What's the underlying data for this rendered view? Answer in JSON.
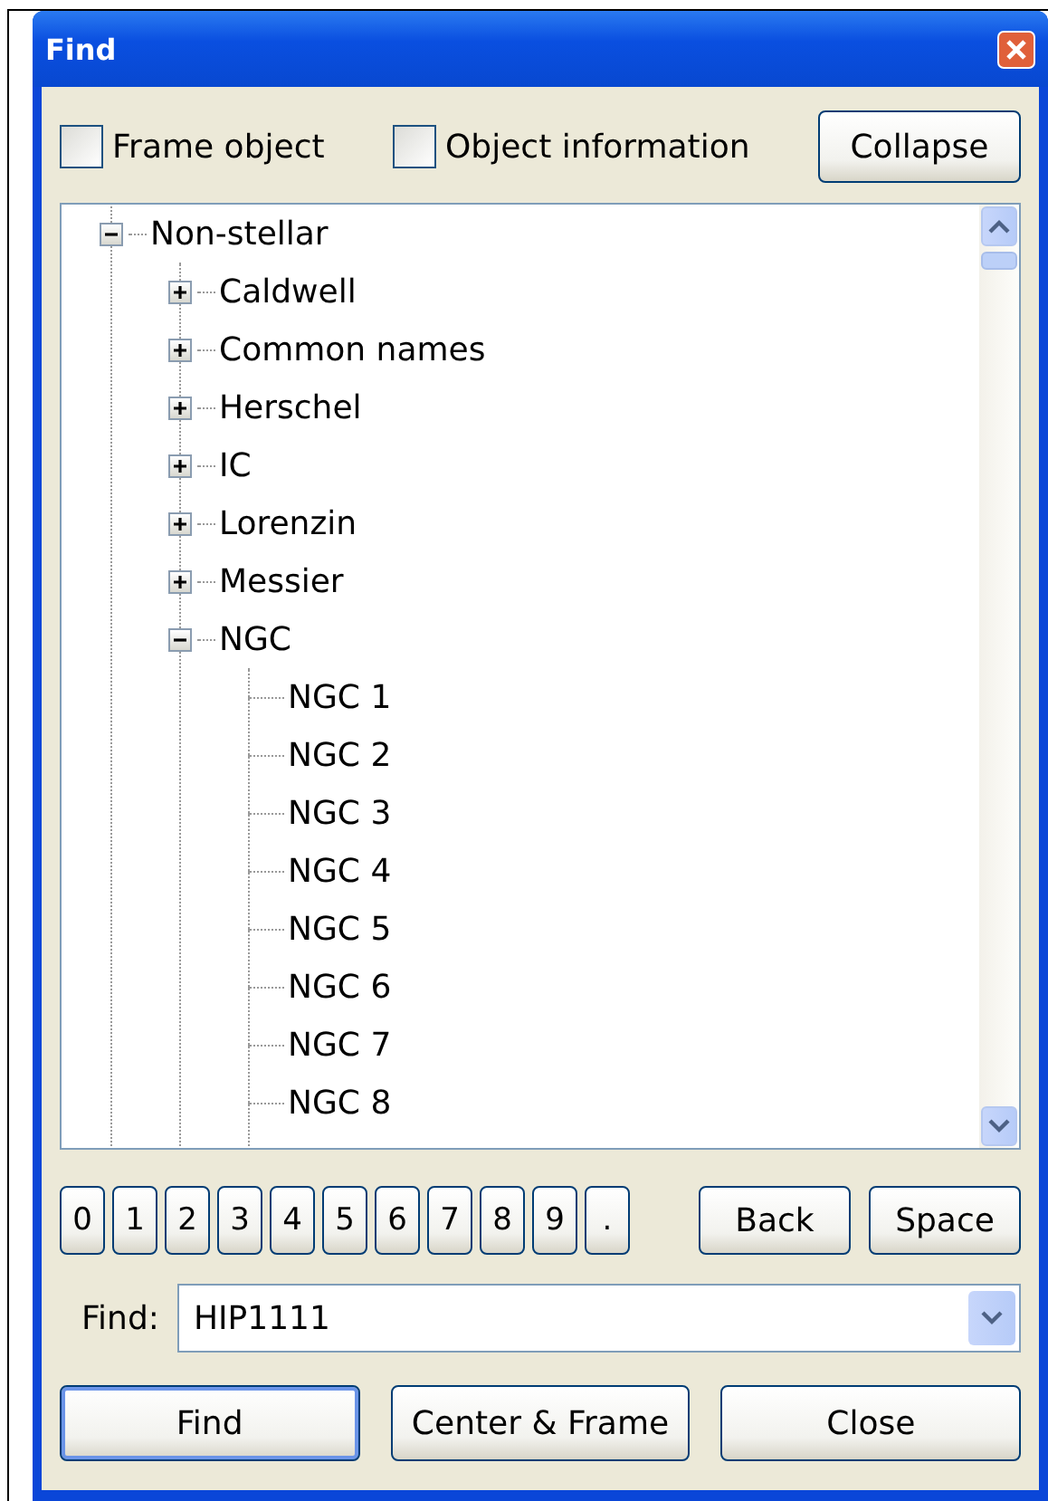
{
  "window": {
    "title": "Find"
  },
  "options": [
    {
      "label": "Frame object",
      "checked": false
    },
    {
      "label": "Object information",
      "checked": false
    }
  ],
  "collapse_button": "Collapse",
  "tree": [
    {
      "label": "Non-stellar",
      "expanded": true,
      "children": [
        {
          "label": "Caldwell",
          "expanded": false
        },
        {
          "label": "Common names",
          "expanded": false
        },
        {
          "label": "Herschel",
          "expanded": false
        },
        {
          "label": "IC",
          "expanded": false
        },
        {
          "label": "Lorenzin",
          "expanded": false
        },
        {
          "label": "Messier",
          "expanded": false
        },
        {
          "label": "NGC",
          "expanded": true,
          "children": [
            {
              "label": "NGC 1"
            },
            {
              "label": "NGC 2"
            },
            {
              "label": "NGC 3"
            },
            {
              "label": "NGC 4"
            },
            {
              "label": "NGC 5"
            },
            {
              "label": "NGC 6"
            },
            {
              "label": "NGC 7"
            },
            {
              "label": "NGC 8"
            }
          ]
        }
      ]
    }
  ],
  "keypad": [
    "0",
    "1",
    "2",
    "3",
    "4",
    "5",
    "6",
    "7",
    "8",
    "9",
    "."
  ],
  "edit_buttons": [
    "Back",
    "Space"
  ],
  "find_field": {
    "label": "Find:",
    "value": "HIP1111"
  },
  "buttons": [
    {
      "label": "Find",
      "default": true
    },
    {
      "label": "Center & Frame",
      "default": false
    },
    {
      "label": "Close",
      "default": false
    }
  ]
}
